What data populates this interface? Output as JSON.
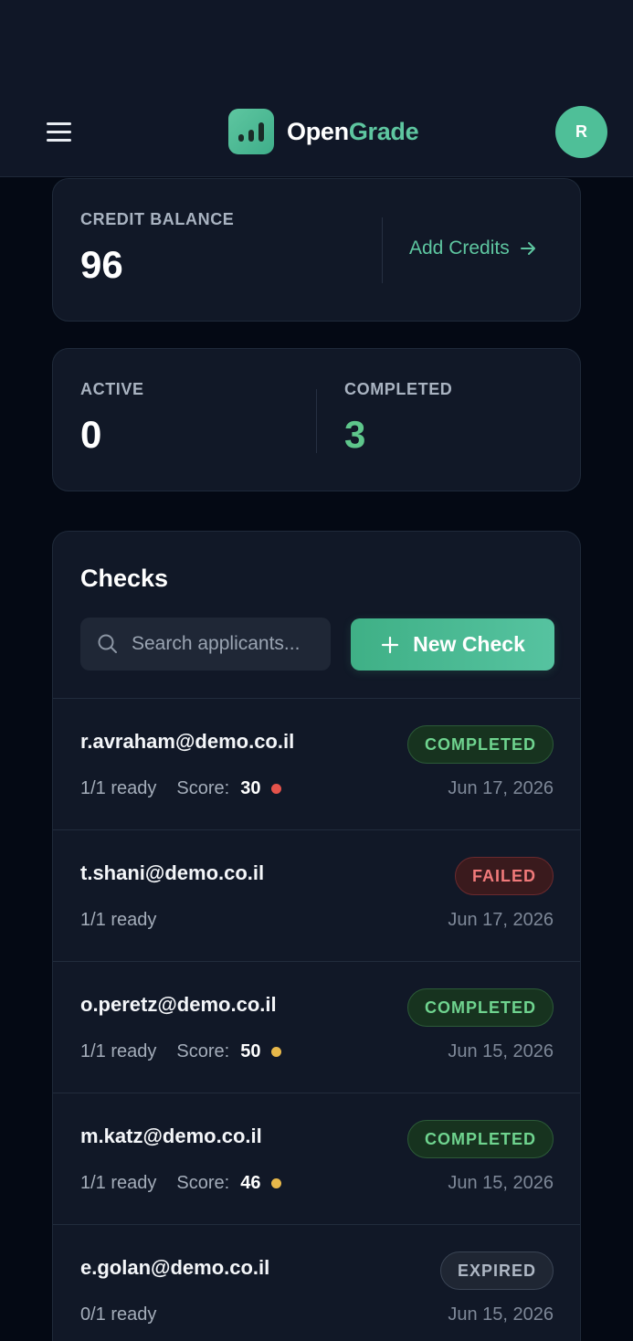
{
  "header": {
    "brand_part1": "Open",
    "brand_part2": "Grade",
    "avatar_initial": "R",
    "menu_icon": "hamburger-icon",
    "logo_icon": "bar-chart-icon"
  },
  "credit": {
    "label": "CREDIT BALANCE",
    "value": "96",
    "add_label": "Add Credits"
  },
  "stats": {
    "active_label": "ACTIVE",
    "active_value": "0",
    "completed_label": "COMPLETED",
    "completed_value": "3"
  },
  "checks": {
    "title": "Checks",
    "search_placeholder": "Search applicants...",
    "new_check_label": "New Check",
    "score_label": "Score:",
    "rows": [
      {
        "email": "r.avraham@demo.co.il",
        "status": "COMPLETED",
        "status_type": "completed",
        "ready": "1/1 ready",
        "score": "30",
        "dot_color": "#e5534b",
        "date": "Jun 17, 2026"
      },
      {
        "email": "t.shani@demo.co.il",
        "status": "FAILED",
        "status_type": "failed",
        "ready": "1/1 ready",
        "score": null,
        "dot_color": null,
        "date": "Jun 17, 2026"
      },
      {
        "email": "o.peretz@demo.co.il",
        "status": "COMPLETED",
        "status_type": "completed",
        "ready": "1/1 ready",
        "score": "50",
        "dot_color": "#e8b84a",
        "date": "Jun 15, 2026"
      },
      {
        "email": "m.katz@demo.co.il",
        "status": "COMPLETED",
        "status_type": "completed",
        "ready": "1/1 ready",
        "score": "46",
        "dot_color": "#e8b84a",
        "date": "Jun 15, 2026"
      },
      {
        "email": "e.golan@demo.co.il",
        "status": "EXPIRED",
        "status_type": "expired",
        "ready": "0/1 ready",
        "score": null,
        "dot_color": null,
        "date": "Jun 15, 2026"
      }
    ]
  },
  "colors": {
    "accent": "#5ec6a0",
    "completed_green": "#5ec68b",
    "background": "#040914",
    "card": "#111827"
  }
}
